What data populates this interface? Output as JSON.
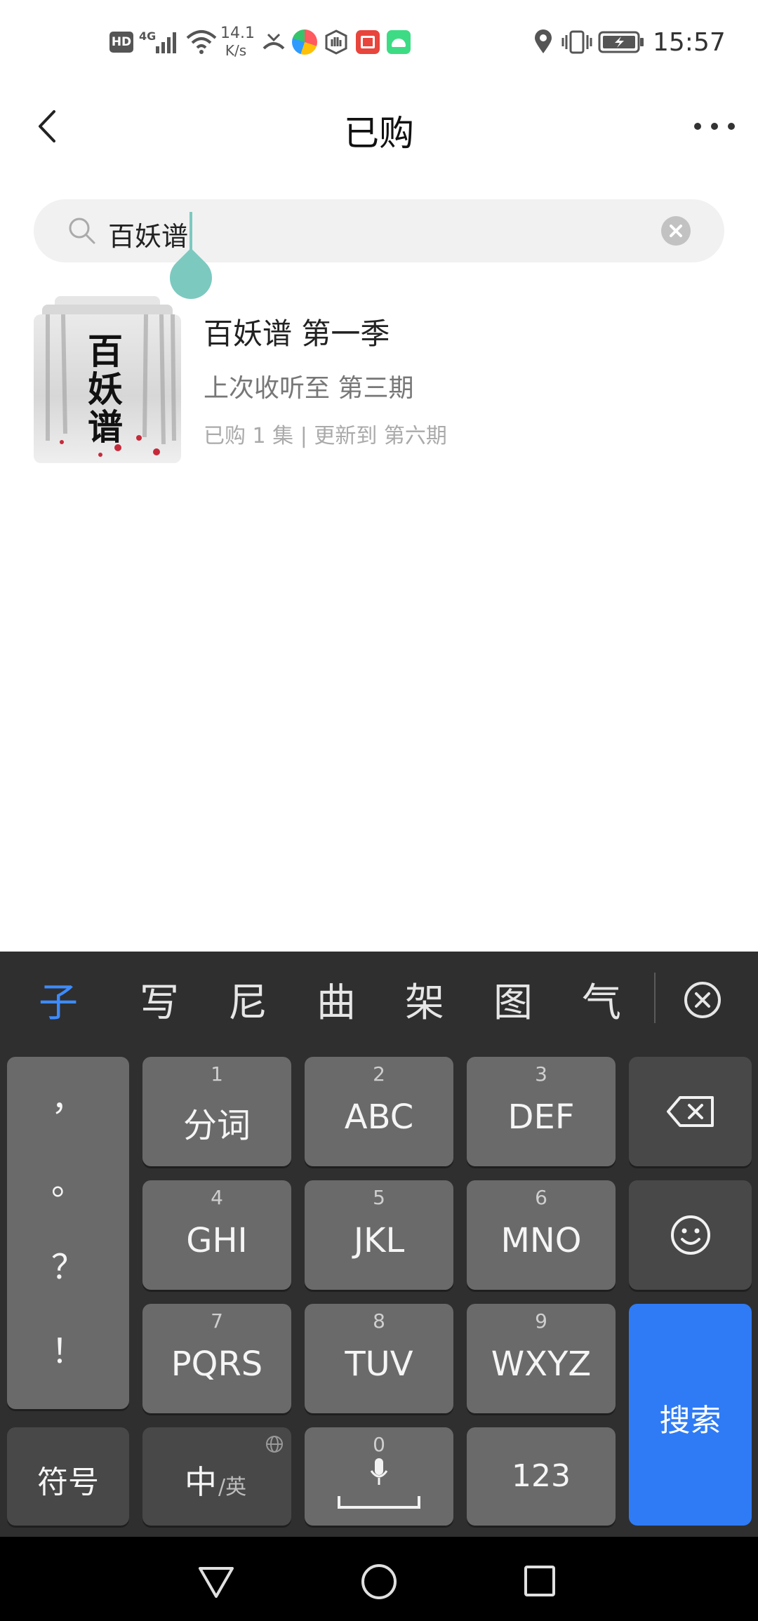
{
  "status_bar": {
    "hd": "HD",
    "net": "4G",
    "speed_value": "14.1",
    "speed_unit": "K/s",
    "time": "15:57",
    "icons": [
      "hd-icon",
      "signal-icon",
      "wifi-icon",
      "missed-call-icon",
      "browser-app-icon",
      "shield-app-icon",
      "book-app-icon",
      "android-app-icon",
      "location-icon",
      "vibrate-icon",
      "battery-icon"
    ]
  },
  "header": {
    "title": "已购"
  },
  "search": {
    "value": "百妖谱"
  },
  "result": {
    "title": "百妖谱 第一季",
    "progress": "上次收听至 第三期",
    "meta": "已购 1 集 | 更新到 第六期",
    "cover_text": "百妖谱"
  },
  "keyboard": {
    "candidates": [
      "子",
      "写",
      "尼",
      "曲",
      "架",
      "图",
      "气"
    ],
    "punct": [
      "，",
      "。",
      "？",
      "！"
    ],
    "keys": [
      {
        "num": "1",
        "label": "分词"
      },
      {
        "num": "2",
        "label": "ABC"
      },
      {
        "num": "3",
        "label": "DEF"
      },
      {
        "num": "4",
        "label": "GHI"
      },
      {
        "num": "5",
        "label": "JKL"
      },
      {
        "num": "6",
        "label": "MNO"
      },
      {
        "num": "7",
        "label": "PQRS"
      },
      {
        "num": "8",
        "label": "TUV"
      },
      {
        "num": "9",
        "label": "WXYZ"
      }
    ],
    "symbol_label": "符号",
    "lang_main": "中",
    "lang_sub": "/英",
    "space_num": "0",
    "num_label": "123",
    "search_label": "搜索",
    "accent": "#2f7bf5"
  }
}
